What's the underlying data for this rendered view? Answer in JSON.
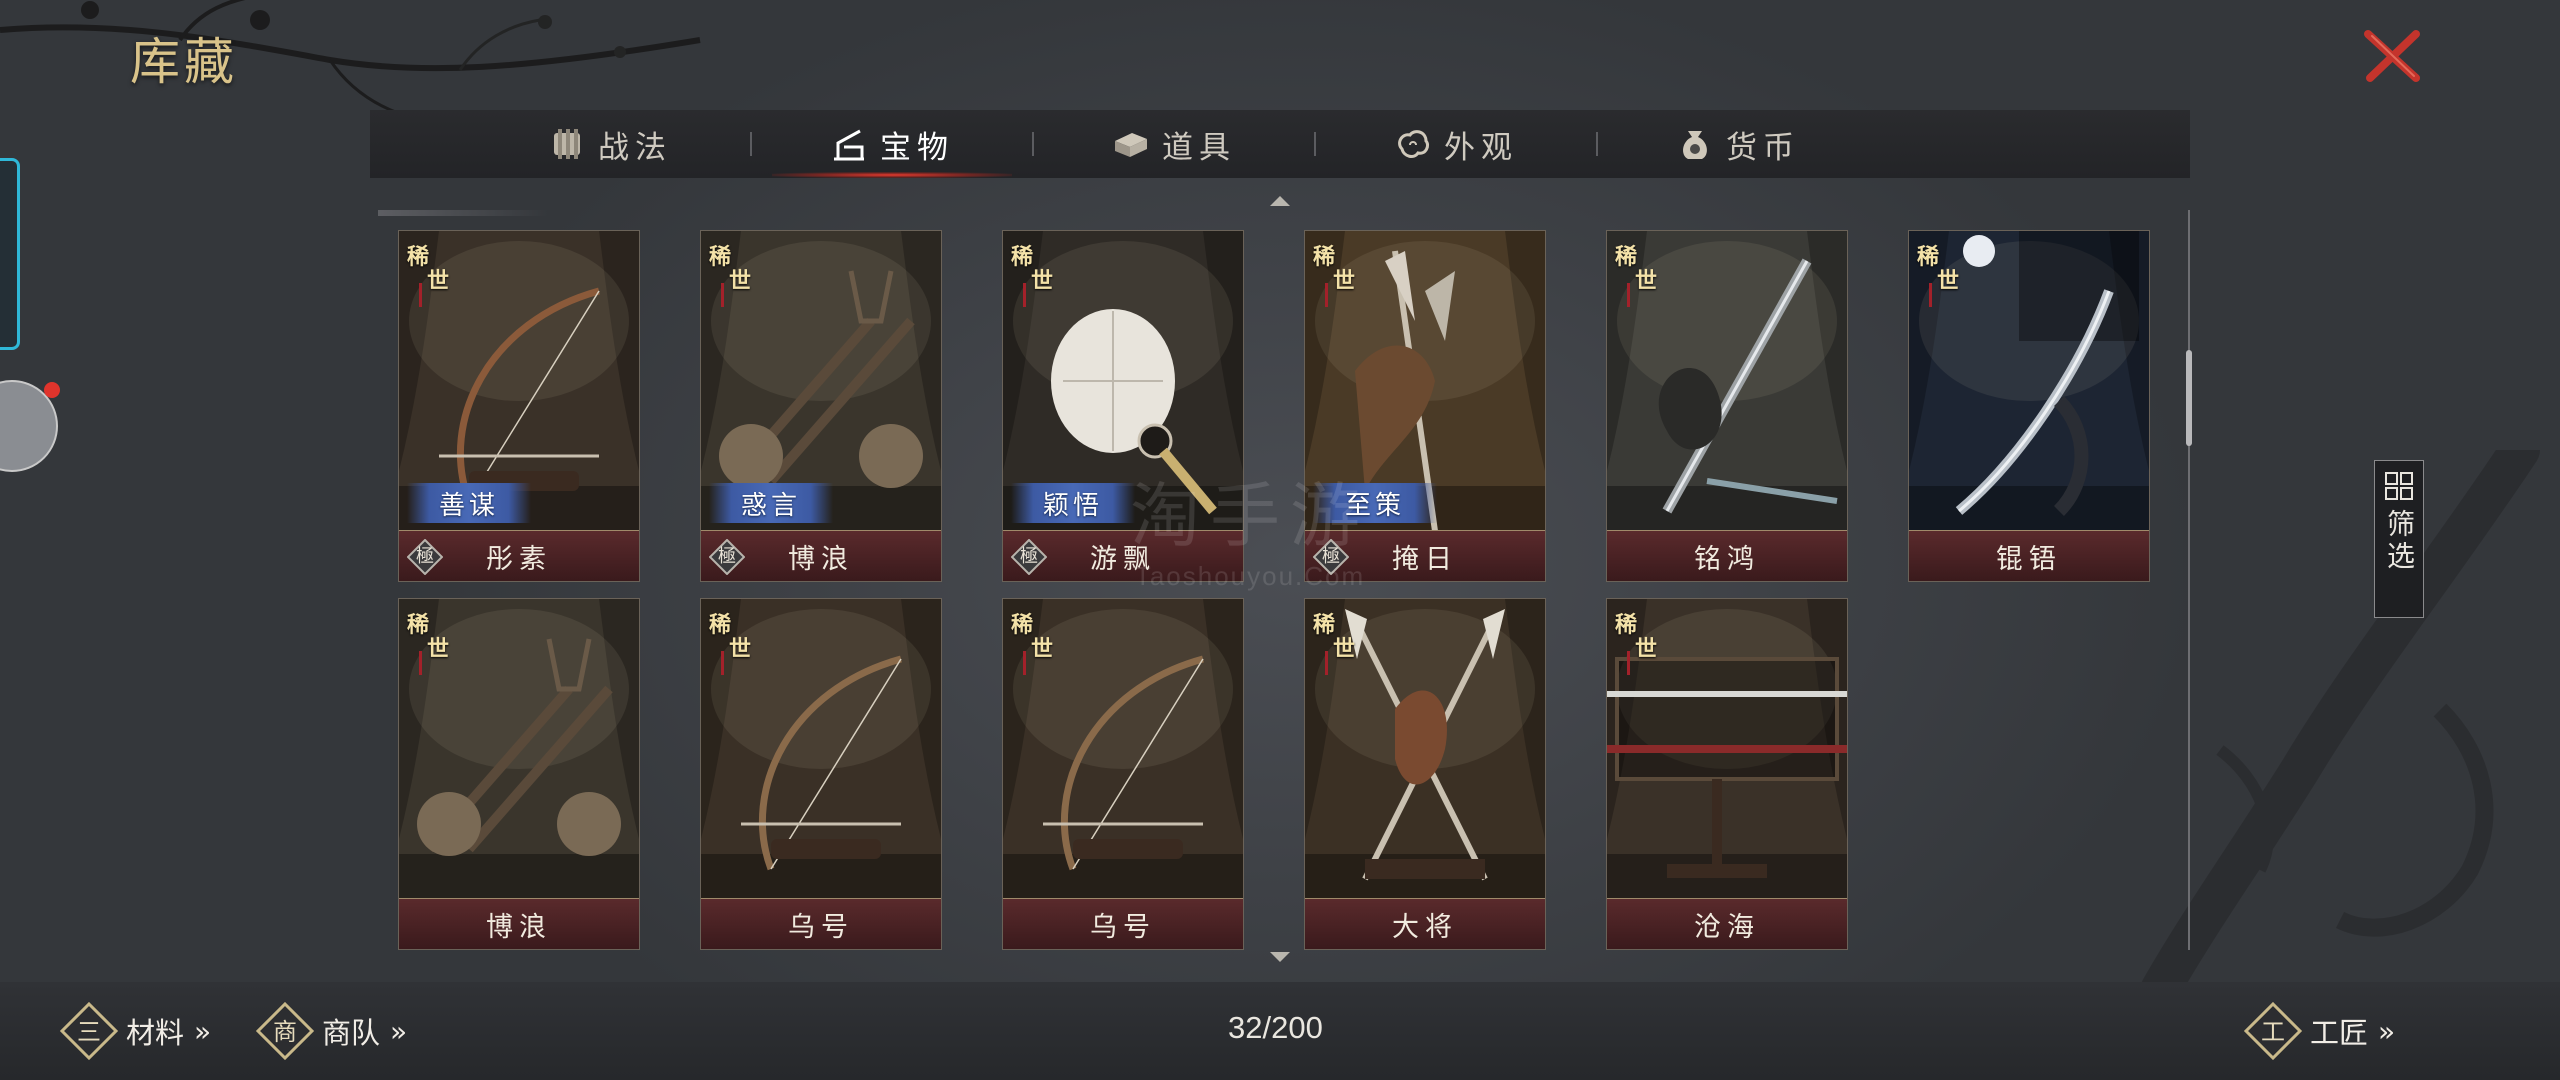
{
  "header": {
    "title": "库藏"
  },
  "tabs": [
    {
      "label": "战法",
      "icon": "scroll-bundle-icon",
      "active": false
    },
    {
      "label": "宝物",
      "icon": "treasure-stand-icon",
      "active": true
    },
    {
      "label": "道具",
      "icon": "box-icon",
      "active": false
    },
    {
      "label": "外观",
      "icon": "cloud-swirl-icon",
      "active": false
    },
    {
      "label": "货币",
      "icon": "coin-pouch-icon",
      "active": false
    }
  ],
  "items": [
    {
      "name": "彤素",
      "rarity": [
        "稀",
        "世"
      ],
      "skill": "善谋",
      "grade": "極",
      "art": "bow-icon",
      "colors": {
        "bg": "#3a3128",
        "accent": "#8b5a3a"
      }
    },
    {
      "name": "博浪",
      "rarity": [
        "稀",
        "世"
      ],
      "skill": "惑言",
      "grade": "極",
      "art": "mace-icon",
      "colors": {
        "bg": "#3a352c",
        "accent": "#7a6a55"
      }
    },
    {
      "name": "游飘",
      "rarity": [
        "稀",
        "世"
      ],
      "skill": "颖悟",
      "grade": "極",
      "art": "feather-fan-icon",
      "colors": {
        "bg": "#2f2b26",
        "accent": "#e8e4dc"
      }
    },
    {
      "name": "掩日",
      "rarity": [
        "稀",
        "世"
      ],
      "skill": "至策",
      "grade": "極",
      "art": "halberd-icon",
      "colors": {
        "bg": "#4a3a26",
        "accent": "#6b4a30"
      }
    },
    {
      "name": "铭鸿",
      "rarity": [
        "稀",
        "世"
      ],
      "skill": "",
      "grade": "",
      "art": "dragon-sword-icon",
      "colors": {
        "bg": "#3a3a36",
        "accent": "#9ea3a6"
      }
    },
    {
      "name": "锟铻",
      "rarity": [
        "稀",
        "世"
      ],
      "skill": "",
      "grade": "",
      "art": "night-sword-icon",
      "colors": {
        "bg": "#1d2533",
        "accent": "#b9c0c8"
      }
    },
    {
      "name": "博浪",
      "rarity": [
        "稀",
        "世"
      ],
      "skill": "",
      "grade": "",
      "art": "mace-icon",
      "colors": {
        "bg": "#3a352c",
        "accent": "#7a6a55"
      }
    },
    {
      "name": "乌号",
      "rarity": [
        "稀",
        "世"
      ],
      "skill": "",
      "grade": "",
      "art": "bow-stand-icon",
      "colors": {
        "bg": "#3a3026",
        "accent": "#8a6a4a"
      }
    },
    {
      "name": "乌号",
      "rarity": [
        "稀",
        "世"
      ],
      "skill": "",
      "grade": "",
      "art": "bow-stand-icon",
      "colors": {
        "bg": "#3a3026",
        "accent": "#8a6a4a"
      }
    },
    {
      "name": "大将",
      "rarity": [
        "稀",
        "世"
      ],
      "skill": "",
      "grade": "",
      "art": "crossed-spears-icon",
      "colors": {
        "bg": "#3b3024",
        "accent": "#7a4a30"
      }
    },
    {
      "name": "沧海",
      "rarity": [
        "稀",
        "世"
      ],
      "skill": "",
      "grade": "",
      "art": "sword-rack-icon",
      "colors": {
        "bg": "#3a3128",
        "accent": "#8a2a2a"
      }
    }
  ],
  "filter": {
    "label": "筛选"
  },
  "footer": {
    "materials": "材料",
    "materials_icon_char": "三",
    "caravan": "商队",
    "caravan_icon_char": "商",
    "craftsman": "工匠",
    "craftsman_icon_char": "工",
    "chevron": "»",
    "counter": "32/200"
  },
  "watermark": {
    "main": "淘手游",
    "sub": "Taoshouyou.Com"
  },
  "colors": {
    "accent_red": "#e43a2e",
    "title_gold": "#d9c38a",
    "skill_blue": "#4869b6",
    "name_bar": "#4a2224"
  }
}
